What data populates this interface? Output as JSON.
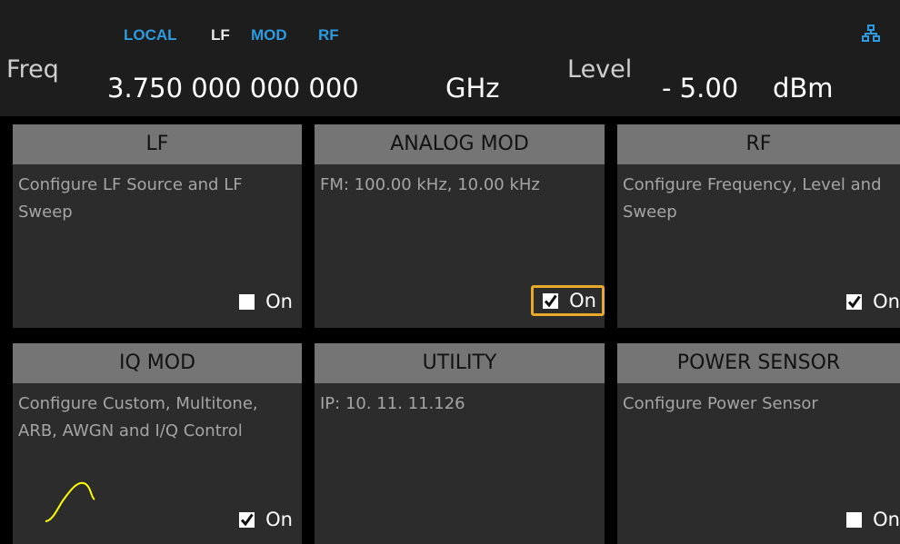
{
  "status": {
    "local": "LOCAL",
    "lf": "LF",
    "mod": "MOD",
    "rf": "RF"
  },
  "network_icon": "network-icon",
  "freq": {
    "label": "Freq",
    "value": "3.750 000 000 000",
    "unit": "GHz"
  },
  "level": {
    "label": "Level",
    "value": "- 5.00",
    "unit": "dBm"
  },
  "colors": {
    "accent_blue": "#2d9be0",
    "focus": "#e9a92a",
    "tile_header": "#757575",
    "tile_bg": "#2c2c2c",
    "wave": "#ffff00"
  },
  "tiles": [
    {
      "title": "LF",
      "desc": "Configure LF Source and LF Sweep",
      "toggle_label": "On",
      "checked": false,
      "focused": false
    },
    {
      "title": "ANALOG MOD",
      "desc": "FM: 100.00 kHz, 10.00 kHz",
      "toggle_label": "On",
      "checked": true,
      "focused": true
    },
    {
      "title": "RF",
      "desc": "Configure Frequency, Level and Sweep",
      "toggle_label": "On",
      "checked": true,
      "focused": false
    },
    {
      "title": "IQ MOD",
      "desc": "Configure Custom, Multitone, ARB, AWGN and I/Q Control",
      "toggle_label": "On",
      "checked": true,
      "focused": false
    },
    {
      "title": "UTILITY",
      "desc": "IP:  10. 11. 11.126",
      "toggle_label": "",
      "checked": false,
      "focused": false
    },
    {
      "title": "POWER SENSOR",
      "desc": "Configure Power Sensor",
      "toggle_label": "On",
      "checked": false,
      "focused": false
    }
  ]
}
